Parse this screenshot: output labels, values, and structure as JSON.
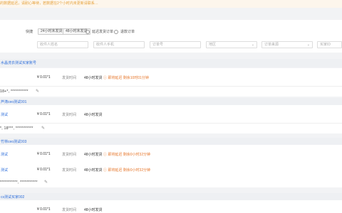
{
  "notice": "的数据延迟，请耐心等待，若数据在2个小时内未更新请联系…",
  "filters": {
    "quick_label": "快捷",
    "chip1": "24小时未发货",
    "chip2": "48小时未发货",
    "check1": "延迟发货订单",
    "check2": "退款订单",
    "input1_placeholder": "收件人姓名",
    "input2_placeholder": "收件人手机",
    "input3_placeholder": "订单号",
    "select1_placeholder": "地区",
    "select2_placeholder": "订单来源",
    "input4_placeholder": "买家ID"
  },
  "groups": [
    {
      "shop": "水晶洗衣测试买家账号",
      "orders": [
        {
          "name": "",
          "price": "¥ 0.01*1",
          "ship_label": "发货时间",
          "ship_value": "48小时发货",
          "warn": "ⓘ 即将延迟 剩余10时01分钟"
        }
      ],
      "address": "18+*, ***********"
    },
    {
      "shop": "芦涛ceo测试001",
      "orders": [
        {
          "name": "测试",
          "price": "¥ 0.01*1",
          "ship_label": "发货时间",
          "ship_value": "48小时发货",
          "warn": ""
        }
      ],
      "address": "*, 18***, ***********"
    },
    {
      "shop": "竹林ceo测试003",
      "orders": [
        {
          "name": "测试",
          "price": "¥ 0.01*1",
          "ship_label": "发货时间",
          "ship_value": "48小时发货",
          "warn": "ⓘ 即将延迟 剩余0小时32分钟"
        },
        {
          "name": "测试",
          "price": "¥ 0.01*1",
          "ship_label": "发货时间",
          "ship_value": "48小时发货",
          "warn": "ⓘ 即将延迟 剩余0小时32分钟"
        }
      ],
      "address": "***********, ***********"
    },
    {
      "shop": "cs测试买家002",
      "orders": [
        {
          "name": "",
          "price": "¥ 0.01*1",
          "ship_label": "发货时间",
          "ship_value": "48小时发货",
          "warn": ""
        }
      ],
      "address": ""
    }
  ],
  "icons": {
    "edit": "edit-icon"
  }
}
